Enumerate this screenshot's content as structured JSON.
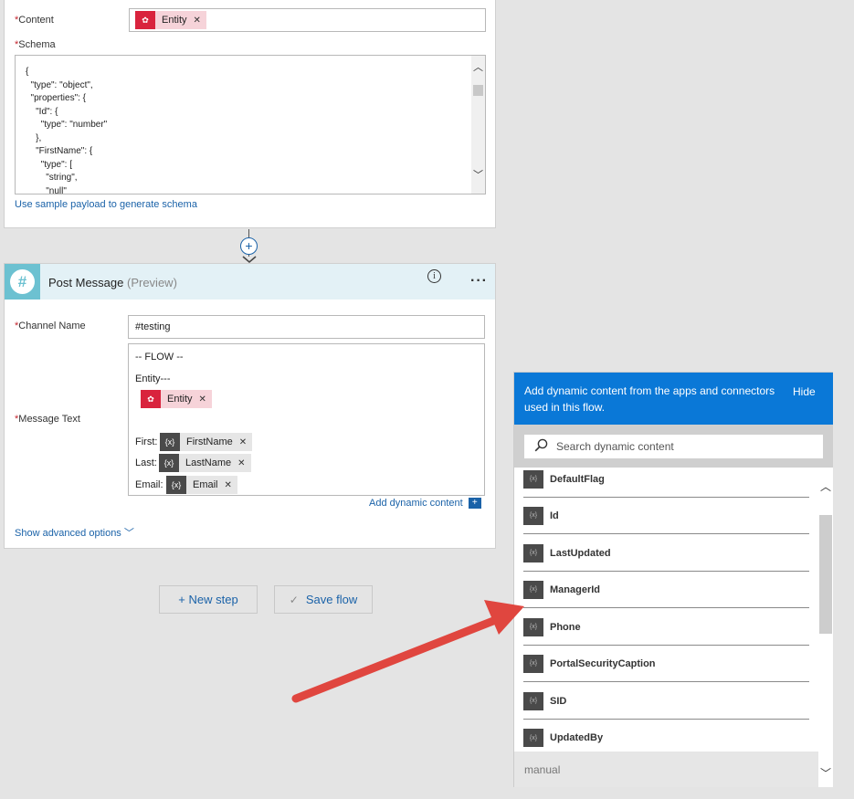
{
  "json_step": {
    "content_label": "Content",
    "content_token": "Entity",
    "schema_label": "Schema",
    "schema_text": "{\n  \"type\": \"object\",\n  \"properties\": {\n    \"Id\": {\n      \"type\": \"number\"\n    },\n    \"FirstName\": {\n      \"type\": [\n        \"string\",\n        \"null\"",
    "sample_payload_link": "Use sample payload to generate schema"
  },
  "post_step": {
    "title": "Post Message",
    "preview": "(Preview)",
    "channel_label": "Channel Name",
    "channel_value": "#testing",
    "message_label": "Message Text",
    "line_flow": "-- FLOW --",
    "line_entity": "Entity---",
    "entity_token": "Entity",
    "first_label": "First:",
    "first_token": "FirstName",
    "last_label": "Last:",
    "last_token": "LastName",
    "email_label": "Email:",
    "email_token": "Email",
    "add_dynamic": "Add dynamic content",
    "show_advanced": "Show advanced options"
  },
  "actions": {
    "new_step": "+ New step",
    "save_flow": "Save flow"
  },
  "dynamic_panel": {
    "header_text": "Add dynamic content from the apps and connectors used in this flow.",
    "hide": "Hide",
    "search_placeholder": "Search dynamic content",
    "items": [
      "DefaultFlag",
      "Id",
      "LastUpdated",
      "ManagerId",
      "Phone",
      "PortalSecurityCaption",
      "SID",
      "UpdatedBy"
    ],
    "footer_section": "manual"
  },
  "icons": {
    "slack": "hash-icon",
    "info": "info-icon",
    "more": "more-dots-icon",
    "search": "search-icon",
    "expression": "expression-icon"
  },
  "colors": {
    "accent_blue": "#0a78d7",
    "token_red": "#d9233d",
    "arrow_red": "#e0463f"
  }
}
